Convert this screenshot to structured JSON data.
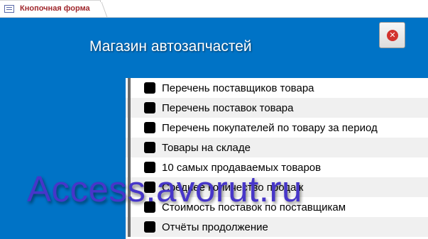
{
  "tab": {
    "title": "Кнопочная форма",
    "icon": "form-icon"
  },
  "form": {
    "title": "Магазин автозапчастей",
    "close_icon": "close-icon",
    "accent_color": "#0073c6"
  },
  "menu": {
    "items": [
      {
        "label": "Перечень поставщиков товара"
      },
      {
        "label": "Перечень поставок товара"
      },
      {
        "label": "Перечень покупателей по товару за период"
      },
      {
        "label": "Товары на складе"
      },
      {
        "label": "10 самых продаваемых товаров"
      },
      {
        "label": "Среднее количество продаж"
      },
      {
        "label": "Стоимость поставок по поставщикам"
      },
      {
        "label": "Отчёты продолжение"
      }
    ]
  },
  "watermark": {
    "text": "Access.avorut.ru"
  }
}
